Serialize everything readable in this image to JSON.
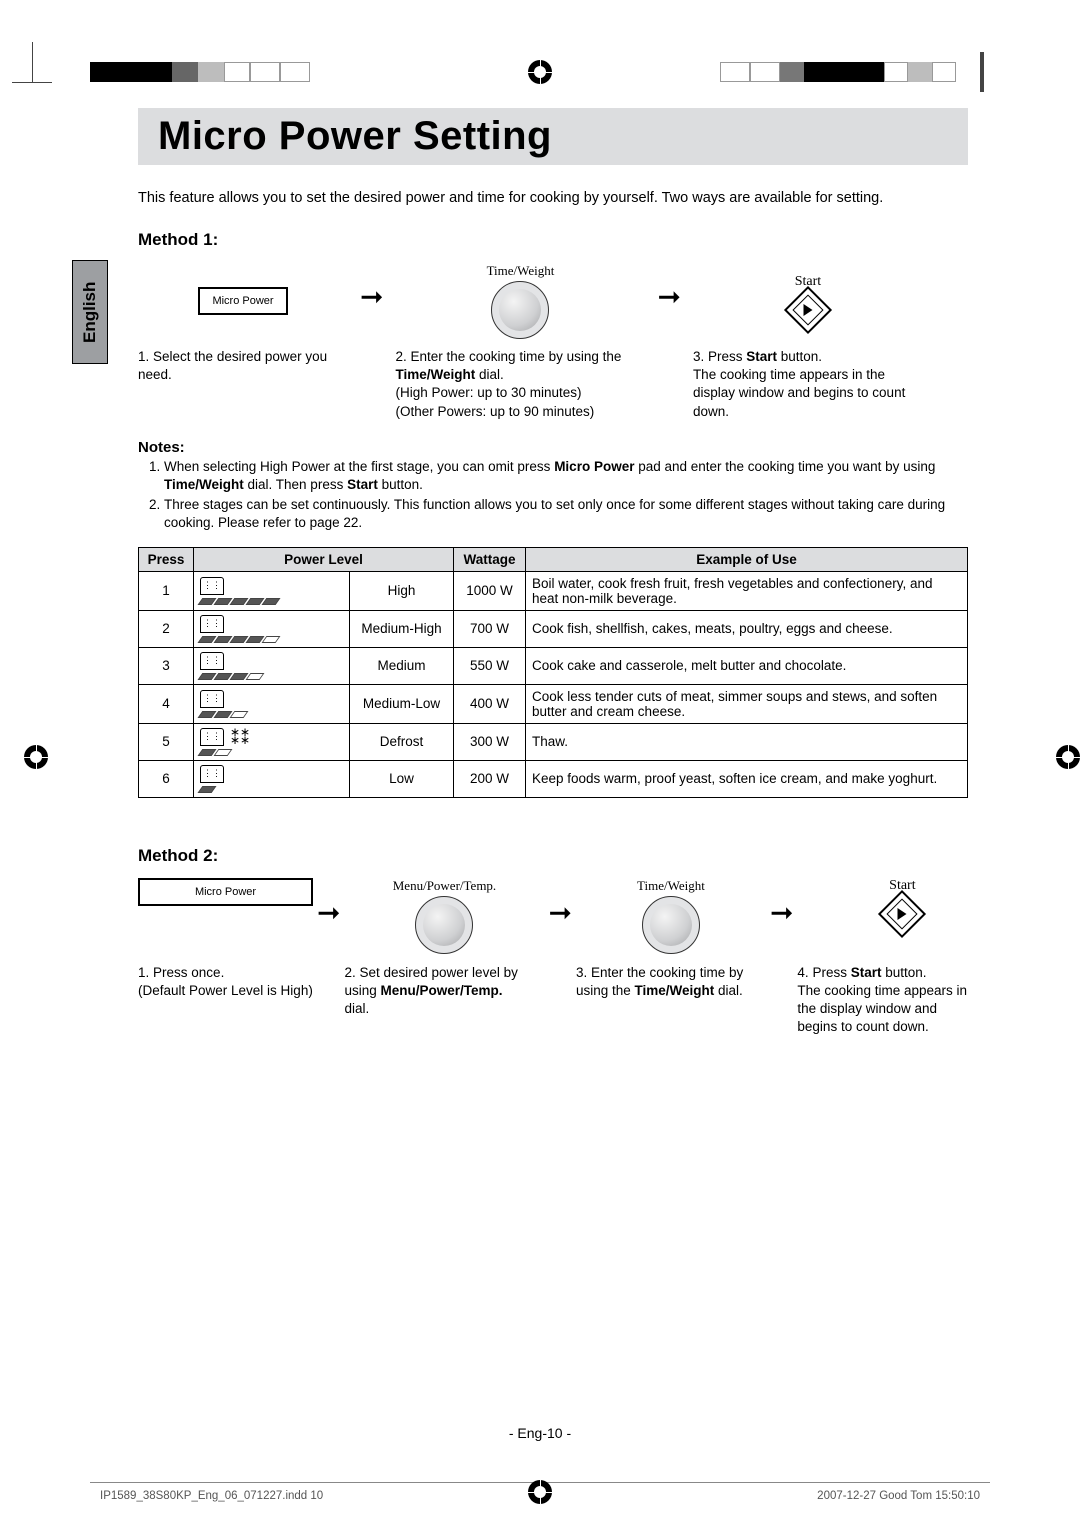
{
  "language_tab": "English",
  "title": "Micro Power Setting",
  "intro": "This feature allows you to set the desired power and time for cooking by yourself. Two ways are available for setting.",
  "method1": {
    "heading": "Method 1:",
    "mp_button": "Micro Power",
    "dial_label": "Time/Weight",
    "start_label": "Start",
    "step1_num": "1.",
    "step1_a": "Select the desired power you need.",
    "step2_num": "2.",
    "step2_a": "Enter the cooking time by using the ",
    "step2_b": "Time/Weight",
    "step2_c": " dial.",
    "step2_d": "(High Power: up to 30 minutes)",
    "step2_e": "(Other Powers: up to 90 minutes)",
    "step3_num": "3.",
    "step3_a": "Press ",
    "step3_b": "Start",
    "step3_c": " button.",
    "step3_d": "The cooking time appears in the display window and begins to count down."
  },
  "notes_head": "Notes:",
  "notes": {
    "n1_a": "When selecting High Power at the first stage, you can omit press ",
    "n1_b": "Micro Power",
    "n1_c": " pad and enter the cooking time you want by using ",
    "n1_d": "Time/Weight",
    "n1_e": " dial. Then press ",
    "n1_f": "Start",
    "n1_g": " button.",
    "n2": "Three stages can be set continuously. This function allows you to set only once for some different stages without taking care during cooking. Please refer to page 22."
  },
  "table": {
    "headers": {
      "press": "Press",
      "level": "Power Level",
      "watt": "Wattage",
      "example": "Example of Use"
    },
    "rows": [
      {
        "press": "1",
        "bars_on": 5,
        "bars_total": 5,
        "level": "High",
        "wattage": "1000 W",
        "example": "Boil water, cook fresh fruit, fresh vegetables and confectionery, and heat non-milk beverage."
      },
      {
        "press": "2",
        "bars_on": 4,
        "bars_total": 5,
        "level": "Medium-High",
        "wattage": "700 W",
        "example": "Cook fish, shellfish, cakes, meats, poultry, eggs and cheese."
      },
      {
        "press": "3",
        "bars_on": 3,
        "bars_total": 4,
        "level": "Medium",
        "wattage": "550 W",
        "example": "Cook cake and casserole, melt butter and chocolate."
      },
      {
        "press": "4",
        "bars_on": 2,
        "bars_total": 3,
        "level": "Medium-Low",
        "wattage": "400 W",
        "example": "Cook less tender cuts of meat, simmer soups and stews, and soften butter and cream cheese."
      },
      {
        "press": "5",
        "bars_on": 1,
        "bars_total": 2,
        "level": "Defrost",
        "wattage": "300 W",
        "example": "Thaw.",
        "show_defrost_icon": true
      },
      {
        "press": "6",
        "bars_on": 1,
        "bars_total": 1,
        "level": "Low",
        "wattage": "200 W",
        "example": "Keep foods warm, proof yeast, soften ice cream, and make yoghurt."
      }
    ]
  },
  "method2": {
    "heading": "Method 2:",
    "mp_button": "Micro Power",
    "dial1_label": "Menu/Power/Temp.",
    "dial2_label": "Time/Weight",
    "start_label": "Start",
    "step1_num": "1.",
    "step1_a": "Press once.",
    "step1_b": "(Default Power Level is High)",
    "step2_num": "2.",
    "step2_a": "Set desired power level by using ",
    "step2_b": "Menu/Power/Temp.",
    "step2_c": " dial.",
    "step3_num": "3.",
    "step3_a": "Enter the cooking time by using the ",
    "step3_b": "Time/Weight",
    "step3_c": " dial.",
    "step4_num": "4.",
    "step4_a": "Press ",
    "step4_b": "Start",
    "step4_c": " button.",
    "step4_d": "The cooking time appears in the display window and begins to count down."
  },
  "page_number": "- Eng-10 -",
  "indd_file": "IP1589_38S80KP_Eng_06_071227.indd   10",
  "timestamp": "2007-12-27   Good Tom 15:50:10"
}
